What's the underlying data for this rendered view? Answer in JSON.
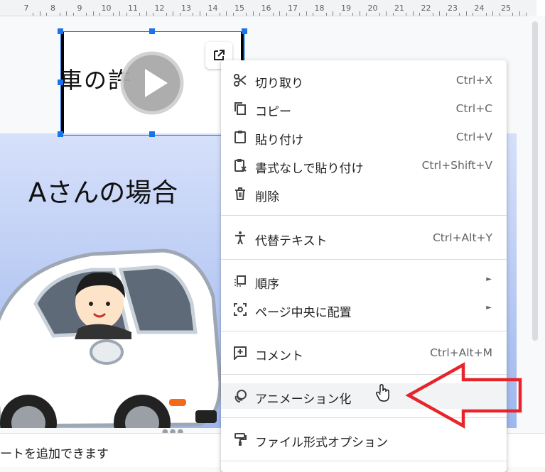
{
  "ruler": {
    "labels": [
      "7",
      "8",
      "9",
      "10",
      "11",
      "12",
      "13",
      "14",
      "15",
      "16",
      "17",
      "18",
      "19",
      "20",
      "21",
      "22",
      "23",
      "24",
      "25"
    ]
  },
  "slide": {
    "heading": "Aさんの場合",
    "video_title": "車の許"
  },
  "notes": {
    "placeholder_text": "ートを追加できます"
  },
  "context_menu": {
    "items": [
      {
        "label": "切り取り",
        "shortcut": "Ctrl+X",
        "icon": "scissors-icon"
      },
      {
        "label": "コピー",
        "shortcut": "Ctrl+C",
        "icon": "copy-icon"
      },
      {
        "label": "貼り付け",
        "shortcut": "Ctrl+V",
        "icon": "clipboard-icon"
      },
      {
        "label": "書式なしで貼り付け",
        "shortcut": "Ctrl+Shift+V",
        "icon": "paste-plain-icon"
      },
      {
        "label": "削除",
        "shortcut": "",
        "icon": "trash-icon"
      },
      {
        "label": "代替テキスト",
        "shortcut": "Ctrl+Alt+Y",
        "icon": "accessibility-icon"
      },
      {
        "label": "順序",
        "shortcut": "",
        "icon": "order-icon",
        "submenu": true
      },
      {
        "label": "ページ中央に配置",
        "shortcut": "",
        "icon": "center-icon",
        "submenu": true
      },
      {
        "label": "コメント",
        "shortcut": "Ctrl+Alt+M",
        "icon": "comment-icon"
      },
      {
        "label": "アニメーション化",
        "shortcut": "",
        "icon": "animation-icon",
        "hovered": true
      },
      {
        "label": "ファイル形式オプション",
        "shortcut": "",
        "icon": "format-paint-icon"
      }
    ],
    "submenu_arrow": "►"
  },
  "colors": {
    "selection": "#1a73e8",
    "annotation_arrow": "#e8232a"
  }
}
